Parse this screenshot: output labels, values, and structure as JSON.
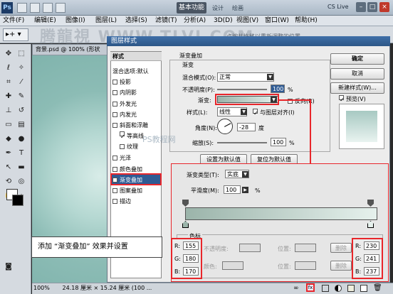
{
  "app": {
    "logo": "Ps",
    "workspace_label": "基本功能",
    "workspace_links": [
      "设计",
      "绘画"
    ],
    "cs_live": "CS Live",
    "window_buttons": [
      "–",
      "□",
      "×"
    ]
  },
  "menu": [
    "文件(F)",
    "编辑(E)",
    "图像(I)",
    "图层(L)",
    "选择(S)",
    "滤镜(T)",
    "分析(A)",
    "3D(D)",
    "视图(V)",
    "窗口(W)",
    "帮助(H)"
  ],
  "options_bar": {
    "hint": "点按并拖移以重新调整的位置。"
  },
  "watermark": "腾龍視 WWW.TLVI.COM",
  "watermark_center": "PS教程网",
  "document": {
    "tab": "背景.psd @ 100% (形状",
    "zoom": "100%",
    "size": "24.18 厘米 × 15.24 厘米 (100 ..."
  },
  "dialog": {
    "title": "图层样式",
    "styles_header": "样式",
    "blend_options": "混合选项:默认",
    "effects": [
      {
        "label": "投影",
        "checked": false
      },
      {
        "label": "内阴影",
        "checked": false
      },
      {
        "label": "外发光",
        "checked": false
      },
      {
        "label": "内发光",
        "checked": false
      },
      {
        "label": "斜面和浮雕",
        "checked": false
      },
      {
        "label": "等高线",
        "checked": true
      },
      {
        "label": "纹理",
        "checked": false
      },
      {
        "label": "光泽",
        "checked": false
      },
      {
        "label": "颜色叠加",
        "checked": false
      },
      {
        "label": "渐变叠加",
        "checked": true
      },
      {
        "label": "图案叠加",
        "checked": false
      },
      {
        "label": "描边",
        "checked": false
      }
    ],
    "section_title": "渐变叠加",
    "subsection": "渐变",
    "blend_mode_label": "混合模式(O):",
    "blend_mode_value": "正常",
    "opacity_label": "不透明度(P):",
    "opacity_value": "100",
    "opacity_unit": "%",
    "gradient_label": "渐变:",
    "reverse_label": "反向(R)",
    "style_label": "样式(L):",
    "style_value": "线性",
    "align_label": "与图层对齐(I)",
    "angle_label": "角度(N):",
    "angle_value": "-28",
    "angle_unit": "度",
    "scale_label": "缩放(S):",
    "scale_value": "100",
    "scale_unit": "%",
    "default_btn": "设置为默认值",
    "reset_btn": "复位为默认值",
    "ok": "确定",
    "cancel": "取消",
    "new_style": "新建样式(W)...",
    "preview_label": "预览(V)"
  },
  "gradient_editor": {
    "type_label": "渐变类型(T):",
    "type_value": "实底",
    "smooth_label": "平滑度(M):",
    "smooth_value": "100",
    "smooth_unit": "%",
    "stops_title": "色标",
    "opacity_label": "不透明度:",
    "location_label": "位置:",
    "color_label": "颜色:",
    "delete_label": "删除",
    "left_color": {
      "R": "155",
      "G": "180",
      "B": "170"
    },
    "right_color": {
      "R": "230",
      "G": "241",
      "B": "237"
    }
  },
  "caption": "添加 “渐变叠加” 效果并设置",
  "colors": {
    "gradient_start": "#9bb4aa",
    "gradient_end": "#e6f1ed",
    "highlight": "#e8262b",
    "title_blue": "#2d5787"
  }
}
